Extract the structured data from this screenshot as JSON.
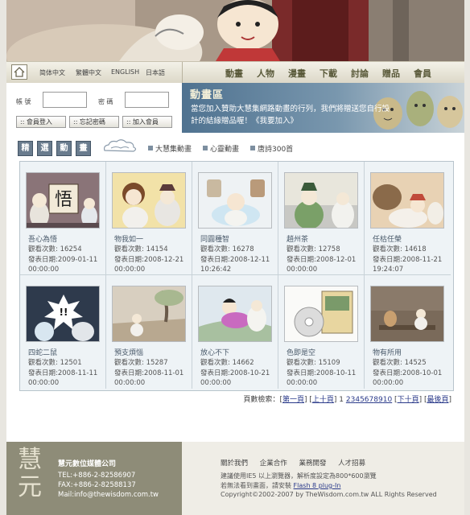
{
  "nav": {
    "languages": [
      "简体中文",
      "繁體中文",
      "ENGLISH",
      "日本語"
    ],
    "items": [
      "動畫",
      "人物",
      "漫畫",
      "下載",
      "討論",
      "贈品",
      "會員"
    ]
  },
  "login": {
    "account_label": "帳 號",
    "password_label": "密 碼",
    "buttons": [
      ":: 會員登入",
      ":: 忘記密碼",
      ":: 加入會員"
    ]
  },
  "promo": {
    "title": "動畫區",
    "text": "當您加入贊助大慧集網路動畫的行列，我們將贈送您自行設計的結緣贈品喔！",
    "link": "《我要加入》"
  },
  "categories": {
    "selected_tiles": [
      "精",
      "選",
      "動",
      "畫"
    ],
    "items": [
      "大慧集動畫",
      "心靈動畫",
      "唐詩300首"
    ]
  },
  "videos": [
    {
      "title": "吾心為悟",
      "views": "觀看次數: 16254",
      "date": "發表日期:2009-01-11 00:00:00"
    },
    {
      "title": "物我如一",
      "views": "觀看次數: 14154",
      "date": "發表日期:2008-12-21 00:00:00"
    },
    {
      "title": "同圓種智",
      "views": "觀看次數: 16278",
      "date": "發表日期:2008-12-11 10:26:42"
    },
    {
      "title": "趙州茶",
      "views": "觀看次數: 12758",
      "date": "發表日期:2008-12-01 00:00:00"
    },
    {
      "title": "任枯任榮",
      "views": "觀看次數: 14618",
      "date": "發表日期:2008-11-21 19:24:07"
    },
    {
      "title": "四蛇二鼠",
      "views": "觀看次數: 12501",
      "date": "發表日期:2008-11-11 00:00:00"
    },
    {
      "title": "預支煩惱",
      "views": "觀看次數: 15287",
      "date": "發表日期:2008-11-01 00:00:00"
    },
    {
      "title": "放心不下",
      "views": "觀看次數: 14662",
      "date": "發表日期:2008-10-21 00:00:00"
    },
    {
      "title": "色即是空",
      "views": "觀看次數: 15109",
      "date": "發表日期:2008-10-11 00:00:00"
    },
    {
      "title": "物有所用",
      "views": "觀看次數: 14525",
      "date": "發表日期:2008-10-01 00:00:00"
    }
  ],
  "thumb_text": {
    "wu": "悟"
  },
  "pager": {
    "label": "頁數檢索：",
    "first": "第一頁",
    "prev10": "上十頁",
    "current": "1",
    "pages": [
      "2",
      "3",
      "4",
      "5",
      "6",
      "7",
      "8",
      "9",
      "10"
    ],
    "next10": "下十頁",
    "last": "最後頁"
  },
  "footer": {
    "logo": "慧元",
    "company": "慧元數位媒體公司",
    "tel": "TEL:+886-2-82586907",
    "fax": "FAX:+886-2-82588137",
    "mail": "Mail:info@thewisdom.com.tw",
    "links": [
      "關於我們",
      "企業合作",
      "業務開發",
      "人才招募"
    ],
    "note1": "建議使用IE5 以上瀏覽器，解析度設定為800*600瀏覽",
    "note2": "若無法看到畫面，請安裝",
    "plugin": "Flash 8 plug-In",
    "copyright": "Copyright©2002-2007 by TheWisdom.com.tw ALL Rights Reserved"
  },
  "colors": {
    "accent": "#6a7c8e",
    "footer": "#8e8c78",
    "promo": "#4f7290"
  }
}
